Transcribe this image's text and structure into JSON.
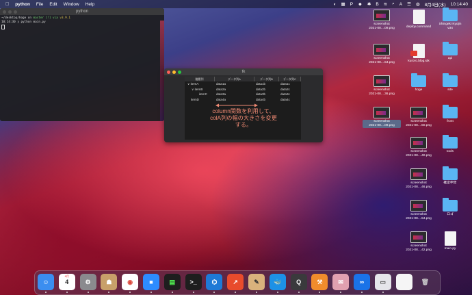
{
  "menubar": {
    "app": "python",
    "items": [
      "File",
      "Edit",
      "Window",
      "Help"
    ],
    "date": "8月4日(水)",
    "time": "10:14:40"
  },
  "terminal": {
    "title": "python",
    "line1a": "~/desktop/hoge on ",
    "line1b": "master [!] via ",
    "line1c": "v3.9.1",
    "line2": "10:14:30 ❯ python main.py"
  },
  "tk": {
    "title": "tk",
    "headers": [
      "階層列",
      "データ列A",
      "データ列B",
      "データ列C"
    ],
    "rows": [
      {
        "tree": "∨ itemA",
        "a": "data1a",
        "b": "data1b",
        "c": "data1c",
        "indent": 0
      },
      {
        "tree": "∨ itemB",
        "a": "data2a",
        "b": "data2b",
        "c": "data2c",
        "indent": 1
      },
      {
        "tree": "itemC",
        "a": "data3a",
        "b": "data3b",
        "c": "data3c",
        "indent": 2
      },
      {
        "tree": "itemD",
        "a": "data4a",
        "b": "data4b",
        "c": "data4c",
        "indent": 0
      }
    ],
    "annotation": [
      "column関数を利用して、",
      "colA列の幅の大きさを変更",
      "する。"
    ]
  },
  "desktop": [
    {
      "label": "screenshot\n2021-08....09.png",
      "kind": "shot"
    },
    {
      "label": "deploy.command",
      "kind": "doc"
    },
    {
      "label": "Shingeki Kyojin\nv34",
      "kind": "folder"
    },
    {
      "label": "screenshot\n2021-08....54.png",
      "kind": "shot"
    },
    {
      "label": "kuroro.blog.stk",
      "kind": "docred"
    },
    {
      "label": "api",
      "kind": "folder"
    },
    {
      "label": "screenshot\n2021-08....36.png",
      "kind": "shot"
    },
    {
      "label": "hoge",
      "kind": "folder"
    },
    {
      "label": "site",
      "kind": "folder"
    },
    {
      "label": "screenshot\n2021-08....09.png",
      "kind": "shot",
      "selected": true
    },
    {
      "label": "screenshot\n2021-08....50.png",
      "kind": "shot"
    },
    {
      "label": "front",
      "kind": "folder"
    },
    {
      "label": "screenshot\n2021-08....40.png",
      "kind": "shot"
    },
    {
      "label": "tools",
      "kind": "folder"
    },
    {
      "label": "screenshot\n2021-08....46.png",
      "kind": "shot"
    },
    {
      "label": "確定申告",
      "kind": "folder"
    },
    {
      "label": "screenshot\n2021-08....54.png",
      "kind": "shot"
    },
    {
      "label": "ロゴ",
      "kind": "folder"
    },
    {
      "label": "screenshot\n2021-08....42.png",
      "kind": "shot"
    },
    {
      "label": "main.py",
      "kind": "doc"
    }
  ],
  "dock": [
    {
      "name": "finder",
      "bg": "#3b8ef0",
      "glyph": "☺"
    },
    {
      "name": "calendar",
      "bg": "#ffffff",
      "glyph": "4",
      "color": "#222",
      "sub": "8月"
    },
    {
      "name": "system-preferences",
      "bg": "#8a8a8e",
      "glyph": "⚙"
    },
    {
      "name": "contacts",
      "bg": "#c8a06a",
      "glyph": "☗"
    },
    {
      "name": "chrome",
      "bg": "#ffffff",
      "glyph": "◉",
      "color": "#db4437"
    },
    {
      "name": "zoom",
      "bg": "#2d8cff",
      "glyph": "■"
    },
    {
      "name": "activity-monitor",
      "bg": "#1e1e1e",
      "glyph": "▤",
      "color": "#5f5"
    },
    {
      "name": "terminal",
      "bg": "#1e1e1e",
      "glyph": ">_"
    },
    {
      "name": "vscode",
      "bg": "#1e7ad6",
      "glyph": "⌬"
    },
    {
      "name": "grapher",
      "bg": "#e84b2c",
      "glyph": "↗"
    },
    {
      "name": "preview-tools",
      "bg": "#d9b27c",
      "glyph": "✎",
      "color": "#333"
    },
    {
      "name": "docker",
      "bg": "#1d91e6",
      "glyph": "🐳"
    },
    {
      "name": "quicktime",
      "bg": "#3a3a3c",
      "glyph": "Q"
    },
    {
      "name": "sourcetree",
      "bg": "#f08c2c",
      "glyph": "⚒"
    },
    {
      "name": "textedit",
      "bg": "#e0a0b0",
      "glyph": "✉"
    },
    {
      "name": "infinity",
      "bg": "#1a73e8",
      "glyph": "∞"
    },
    {
      "name": "screenshot-thumb",
      "bg": "#e5e5ea",
      "glyph": "▭",
      "color": "#555"
    },
    {
      "name": "document",
      "bg": "#f5f5f5",
      "glyph": "",
      "color": "#555"
    },
    {
      "name": "trash",
      "bg": "transparent",
      "glyph": "🗑",
      "color": "#ccc"
    }
  ]
}
